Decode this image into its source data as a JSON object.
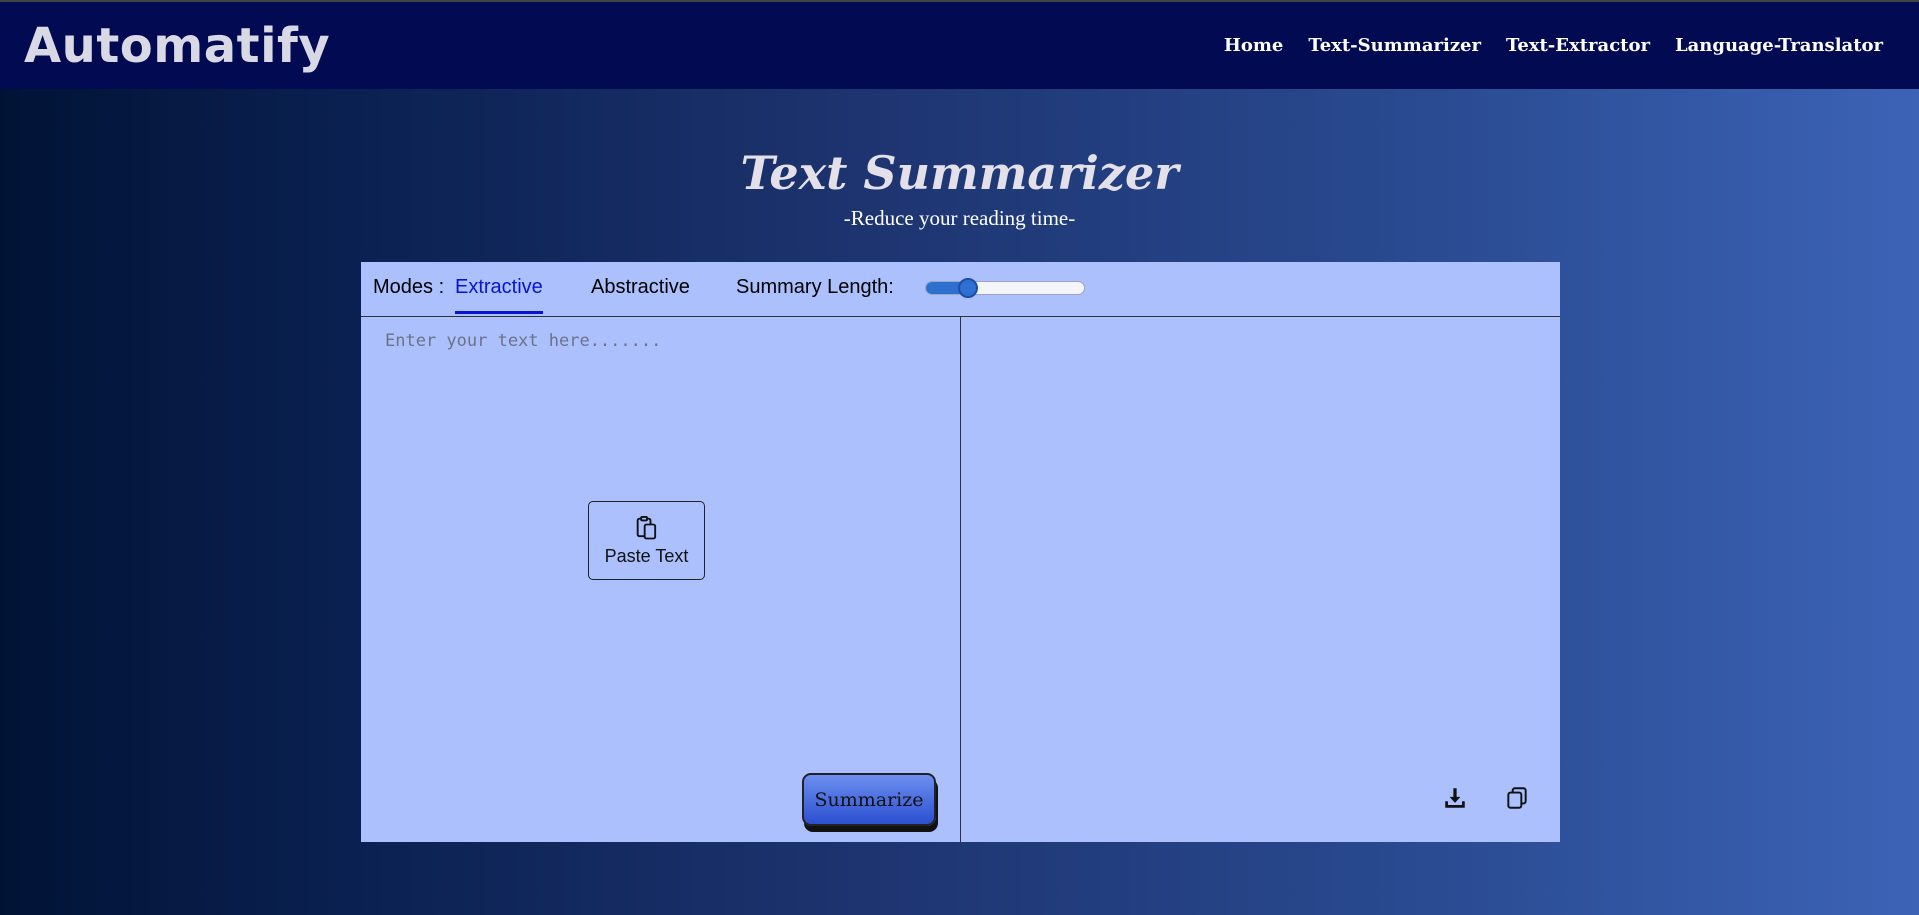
{
  "navbar": {
    "brand": "Automatify",
    "links": [
      "Home",
      "Text-Summarizer",
      "Text-Extractor",
      "Language-Translator"
    ]
  },
  "hero": {
    "title": "Text Summarizer",
    "subtitle": "-Reduce your reading time-"
  },
  "toolbar": {
    "modes_label": "Modes :",
    "modes": [
      "Extractive",
      "Abstractive"
    ],
    "active_mode": "Extractive",
    "length_label": "Summary Length:",
    "length_value": 0.27
  },
  "input": {
    "placeholder": "Enter your text here......."
  },
  "paste_button": {
    "label": "Paste Text",
    "icon": "paste-icon"
  },
  "summarize_button": {
    "label": "Summarize"
  },
  "output_actions": {
    "download_icon": "download-icon",
    "copy_icon": "copy-icon"
  },
  "colors": {
    "navbar": "#020a52",
    "panel": "#abc0fd",
    "active_tab": "#0a14cf"
  }
}
